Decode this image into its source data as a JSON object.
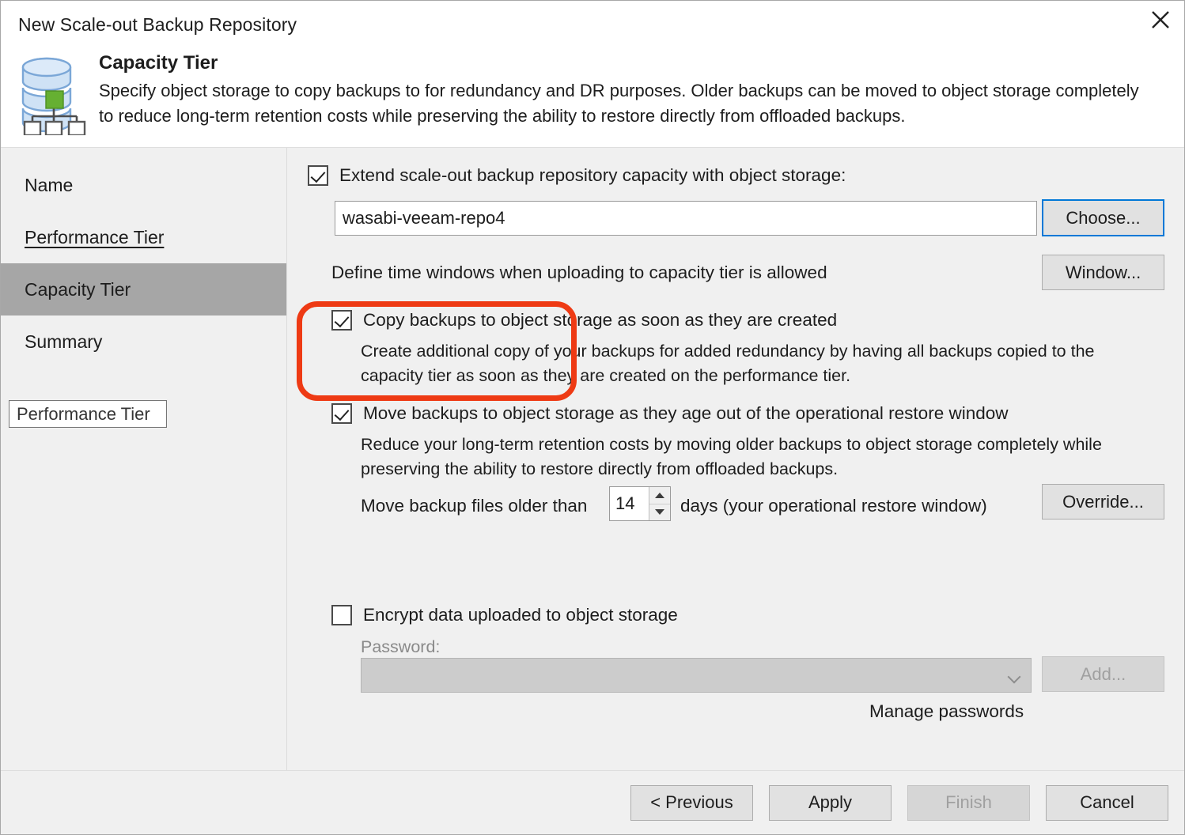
{
  "window": {
    "title": "New Scale-out Backup Repository",
    "close_icon": "close-icon"
  },
  "header": {
    "icon": "scale-out-repository-icon",
    "title": "Capacity Tier",
    "description": "Specify object storage to copy backups to for redundancy and DR purposes. Older backups can be moved to object storage completely to reduce long-term retention costs while preserving the ability to restore directly from offloaded backups."
  },
  "sidebar": {
    "items": [
      {
        "label": "Name",
        "state": "normal"
      },
      {
        "label": "Performance Tier",
        "state": "visited"
      },
      {
        "label": "Capacity Tier",
        "state": "current"
      },
      {
        "label": "Summary",
        "state": "normal"
      }
    ],
    "tooltip": "Performance Tier"
  },
  "main": {
    "extend_checkbox": {
      "label": "Extend scale-out backup repository capacity with object storage:",
      "checked": true
    },
    "repository_field": {
      "value": "wasabi-veeam-repo4",
      "placeholder": ""
    },
    "choose_button": "Choose...",
    "time_window": {
      "label": "Define time windows when uploading to capacity tier is allowed",
      "button": "Window..."
    },
    "copy_backups": {
      "label": "Copy backups to object storage as soon as they are created",
      "checked": true,
      "description": "Create additional copy of your backups for added redundancy by having all backups copied to the capacity tier as soon as they are created on the performance tier."
    },
    "move_backups": {
      "label": "Move backups to object storage as they age out of the operational restore window",
      "checked": true,
      "description": "Reduce your long-term retention costs by moving older backups to object storage completely while preserving the ability to restore directly from offloaded backups.",
      "older_than_prefix": "Move backup files older than",
      "days_value": "14",
      "older_than_suffix": "days (your operational restore window)",
      "override_button": "Override..."
    },
    "encrypt": {
      "label": "Encrypt data uploaded to object storage",
      "checked": false,
      "password_label": "Password:",
      "password_value": "",
      "add_button": "Add...",
      "manage_link": "Manage passwords"
    }
  },
  "footer": {
    "previous": "< Previous",
    "apply": "Apply",
    "finish": "Finish",
    "cancel": "Cancel"
  },
  "annotation": {
    "type": "highlight-rounded-rect",
    "color": "#ee3a14"
  }
}
